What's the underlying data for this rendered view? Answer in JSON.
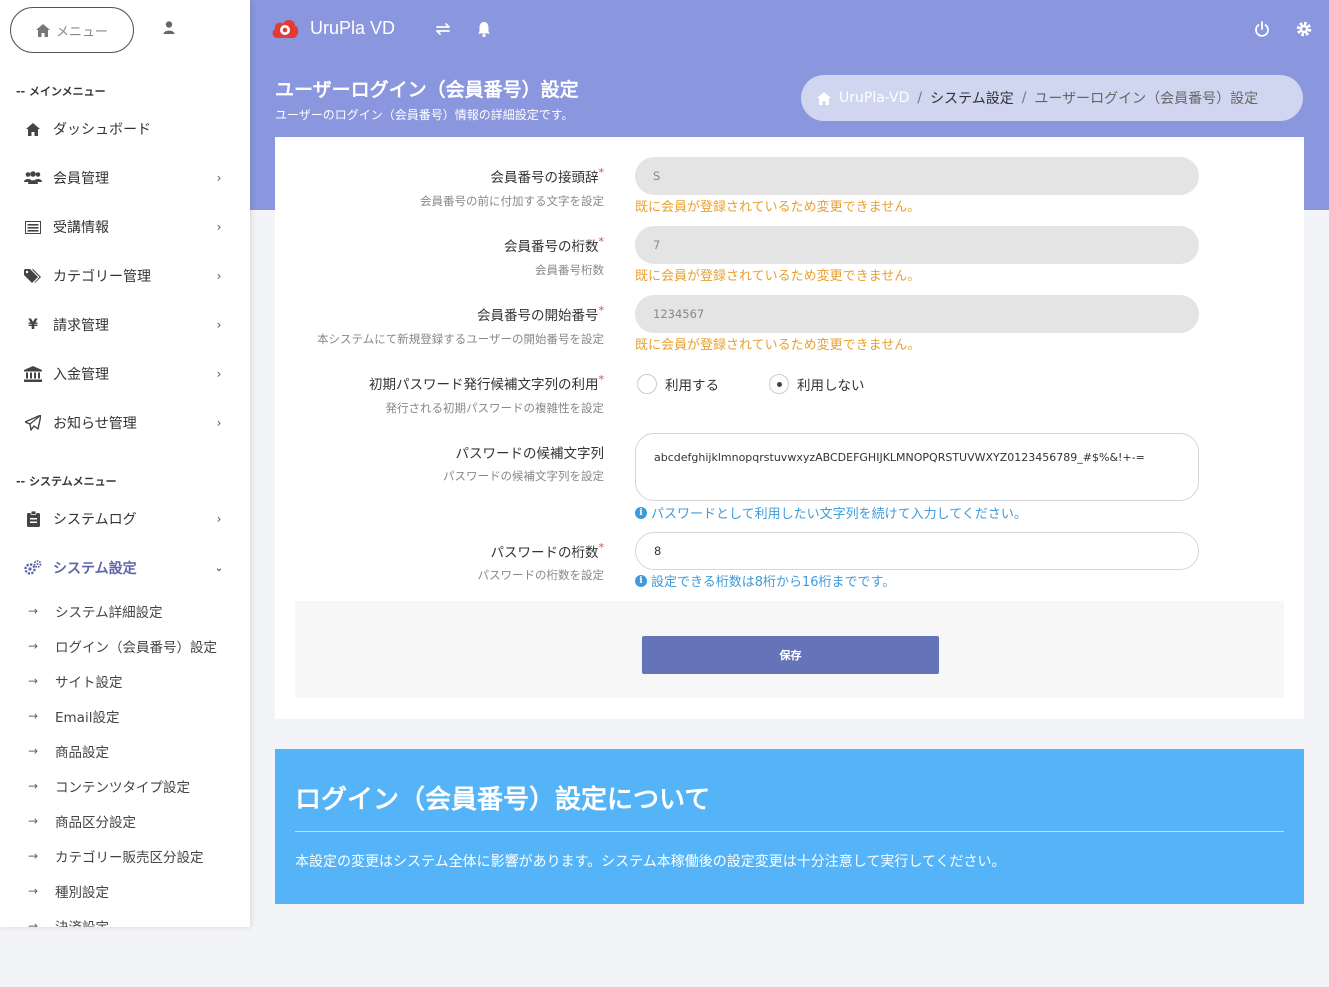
{
  "sidebar": {
    "menu_button": "メニュー",
    "main_menu_heading": "-- メインメニュー",
    "main_items": [
      {
        "label": "ダッシュボード"
      },
      {
        "label": "会員管理"
      },
      {
        "label": "受講情報"
      },
      {
        "label": "カテゴリー管理"
      },
      {
        "label": "請求管理"
      },
      {
        "label": "入金管理"
      },
      {
        "label": "お知らせ管理"
      }
    ],
    "system_menu_heading": "-- システムメニュー",
    "system_items": [
      {
        "label": "システムログ"
      },
      {
        "label": "システム設定"
      }
    ],
    "sub_items": [
      {
        "label": "システム詳細設定"
      },
      {
        "label": "ログイン（会員番号）設定"
      },
      {
        "label": "サイト設定"
      },
      {
        "label": "Email設定"
      },
      {
        "label": "商品設定"
      },
      {
        "label": "コンテンツタイプ設定"
      },
      {
        "label": "商品区分設定"
      },
      {
        "label": "カテゴリー販売区分設定"
      },
      {
        "label": "種別設定"
      },
      {
        "label": "決済設定"
      }
    ]
  },
  "header": {
    "app_title": "UruPla VD",
    "accent_color": "#8a96dd"
  },
  "page": {
    "title": "ユーザーログイン（会員番号）設定",
    "subtitle": "ユーザーのログイン（会員番号）情報の詳細設定です。",
    "breadcrumb": {
      "home": "UruPla-VD",
      "section": "システム設定",
      "current": "ユーザーログイン（会員番号）設定",
      "separator": "/"
    }
  },
  "form": {
    "prefix": {
      "label": "会員番号の接頭辞",
      "required": "*",
      "help": "会員番号の前に付加する文字を設定",
      "value": "S",
      "warning": "既に会員が登録されているため変更できません。"
    },
    "digits": {
      "label": "会員番号の桁数",
      "required": "*",
      "help": "会員番号桁数",
      "value": "7",
      "warning": "既に会員が登録されているため変更できません。"
    },
    "start_number": {
      "label": "会員番号の開始番号",
      "required": "*",
      "help": "本システムにて新規登録するユーザーの開始番号を設定",
      "value": "1234567",
      "warning": "既に会員が登録されているため変更できません。"
    },
    "use_candidates": {
      "label": "初期パスワード発行候補文字列の利用",
      "required": "*",
      "help": "発行される初期パスワードの複雑性を設定",
      "option_yes": "利用する",
      "option_no": "利用しない",
      "selected": "利用しない"
    },
    "candidates": {
      "label": "パスワードの候補文字列",
      "help": "パスワードの候補文字列を設定",
      "value": "abcdefghijklmnopqrstuvwxyzABCDEFGHIJKLMNOPQRSTUVWXYZ0123456789_#$%&!+-=",
      "info": "パスワードとして利用したい文字列を続けて入力してください。"
    },
    "password_digits": {
      "label": "パスワードの桁数",
      "required": "*",
      "help": "パスワードの桁数を設定",
      "value": "8",
      "info": "設定できる桁数は8桁から16桁までです。"
    },
    "save_label": "保存"
  },
  "note": {
    "title": "ログイン（会員番号）設定について",
    "text": "本設定の変更はシステム全体に影響があります。システム本稼働後の設定変更は十分注意して実行してください。"
  }
}
